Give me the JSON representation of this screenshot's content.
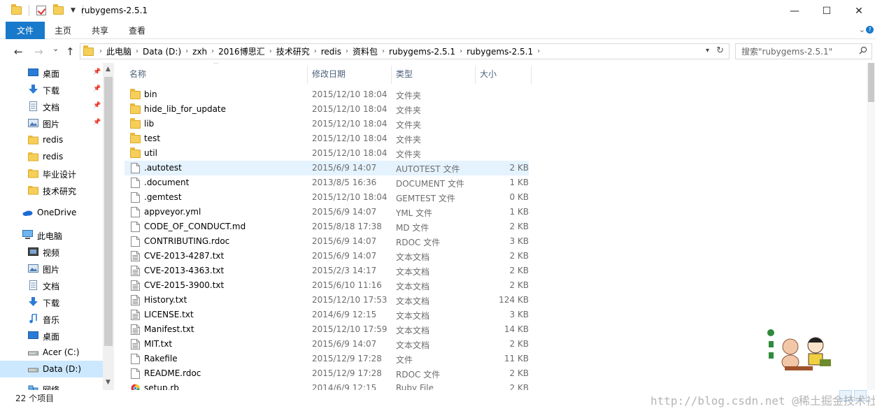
{
  "window": {
    "title": "rubygems-2.5.1",
    "minimize": "—",
    "maximize": "☐",
    "close": "✕"
  },
  "ribbon": {
    "tabs": [
      "文件",
      "主页",
      "共享",
      "查看"
    ]
  },
  "nav": {
    "back": "←",
    "forward": "→",
    "recent": "⌄",
    "up": "↑"
  },
  "address": {
    "crumbs": [
      "此电脑",
      "Data (D:)",
      "zxh",
      "2016博思汇",
      "技术研究",
      "redis",
      "资料包",
      "rubygems-2.5.1",
      "rubygems-2.5.1"
    ]
  },
  "search": {
    "placeholder": "搜索\"rubygems-2.5.1\""
  },
  "sidebar": {
    "items": [
      {
        "label": "桌面",
        "icon": "desktop-icon",
        "pinned": true
      },
      {
        "label": "下载",
        "icon": "download-icon",
        "pinned": true
      },
      {
        "label": "文档",
        "icon": "document-icon",
        "pinned": true
      },
      {
        "label": "图片",
        "icon": "picture-icon",
        "pinned": true
      },
      {
        "label": "redis",
        "icon": "folder-icon",
        "pinned": false
      },
      {
        "label": "redis",
        "icon": "folder-icon",
        "pinned": false
      },
      {
        "label": "毕业设计",
        "icon": "folder-icon",
        "pinned": false
      },
      {
        "label": "技术研究",
        "icon": "folder-icon",
        "pinned": false
      },
      {
        "label": "OneDrive",
        "icon": "onedrive-icon",
        "pinned": false
      },
      {
        "label": "此电脑",
        "icon": "computer-icon",
        "pinned": false
      },
      {
        "label": "视频",
        "icon": "video-icon",
        "pinned": false
      },
      {
        "label": "图片",
        "icon": "picture-icon",
        "pinned": false
      },
      {
        "label": "文档",
        "icon": "document-icon",
        "pinned": false
      },
      {
        "label": "下载",
        "icon": "download-icon",
        "pinned": false
      },
      {
        "label": "音乐",
        "icon": "music-icon",
        "pinned": false
      },
      {
        "label": "桌面",
        "icon": "desktop-icon",
        "pinned": false
      },
      {
        "label": "Acer (C:)",
        "icon": "drive-icon",
        "pinned": false
      },
      {
        "label": "Data (D:)",
        "icon": "drive-icon",
        "pinned": false
      },
      {
        "label": "网络",
        "icon": "network-icon",
        "pinned": false
      }
    ],
    "selected": "Data (D:)"
  },
  "columns": {
    "name": "名称",
    "date": "修改日期",
    "type": "类型",
    "size": "大小"
  },
  "files": [
    {
      "name": "bin",
      "date": "2015/12/10 18:04",
      "type": "文件夹",
      "size": "",
      "kind": "folder"
    },
    {
      "name": "hide_lib_for_update",
      "date": "2015/12/10 18:04",
      "type": "文件夹",
      "size": "",
      "kind": "folder"
    },
    {
      "name": "lib",
      "date": "2015/12/10 18:04",
      "type": "文件夹",
      "size": "",
      "kind": "folder"
    },
    {
      "name": "test",
      "date": "2015/12/10 18:04",
      "type": "文件夹",
      "size": "",
      "kind": "folder"
    },
    {
      "name": "util",
      "date": "2015/12/10 18:04",
      "type": "文件夹",
      "size": "",
      "kind": "folder"
    },
    {
      "name": ".autotest",
      "date": "2015/6/9 14:07",
      "type": "AUTOTEST 文件",
      "size": "2 KB",
      "kind": "file"
    },
    {
      "name": ".document",
      "date": "2013/8/5 16:36",
      "type": "DOCUMENT 文件",
      "size": "1 KB",
      "kind": "file"
    },
    {
      "name": ".gemtest",
      "date": "2015/12/10 18:04",
      "type": "GEMTEST 文件",
      "size": "0 KB",
      "kind": "file"
    },
    {
      "name": "appveyor.yml",
      "date": "2015/6/9 14:07",
      "type": "YML 文件",
      "size": "1 KB",
      "kind": "file"
    },
    {
      "name": "CODE_OF_CONDUCT.md",
      "date": "2015/8/18 17:38",
      "type": "MD 文件",
      "size": "2 KB",
      "kind": "file"
    },
    {
      "name": "CONTRIBUTING.rdoc",
      "date": "2015/6/9 14:07",
      "type": "RDOC 文件",
      "size": "3 KB",
      "kind": "file"
    },
    {
      "name": "CVE-2013-4287.txt",
      "date": "2015/6/9 14:07",
      "type": "文本文档",
      "size": "2 KB",
      "kind": "text"
    },
    {
      "name": "CVE-2013-4363.txt",
      "date": "2015/2/3 14:17",
      "type": "文本文档",
      "size": "2 KB",
      "kind": "text"
    },
    {
      "name": "CVE-2015-3900.txt",
      "date": "2015/6/10 11:16",
      "type": "文本文档",
      "size": "2 KB",
      "kind": "text"
    },
    {
      "name": "History.txt",
      "date": "2015/12/10 17:53",
      "type": "文本文档",
      "size": "124 KB",
      "kind": "text"
    },
    {
      "name": "LICENSE.txt",
      "date": "2014/6/9 12:15",
      "type": "文本文档",
      "size": "3 KB",
      "kind": "text"
    },
    {
      "name": "Manifest.txt",
      "date": "2015/12/10 17:59",
      "type": "文本文档",
      "size": "14 KB",
      "kind": "text"
    },
    {
      "name": "MIT.txt",
      "date": "2015/6/9 14:07",
      "type": "文本文档",
      "size": "2 KB",
      "kind": "text"
    },
    {
      "name": "Rakefile",
      "date": "2015/12/9 17:28",
      "type": "文件",
      "size": "11 KB",
      "kind": "file"
    },
    {
      "name": "README.rdoc",
      "date": "2015/12/9 17:28",
      "type": "RDOC 文件",
      "size": "2 KB",
      "kind": "file"
    },
    {
      "name": "setup.rb",
      "date": "2014/6/9 12:15",
      "type": "Ruby File",
      "size": "2 KB",
      "kind": "ruby"
    }
  ],
  "hovered_row": ".autotest",
  "status": {
    "count": "22 个项目"
  },
  "watermark": "http://blog.csdn.net @稀土掘金技术社区"
}
